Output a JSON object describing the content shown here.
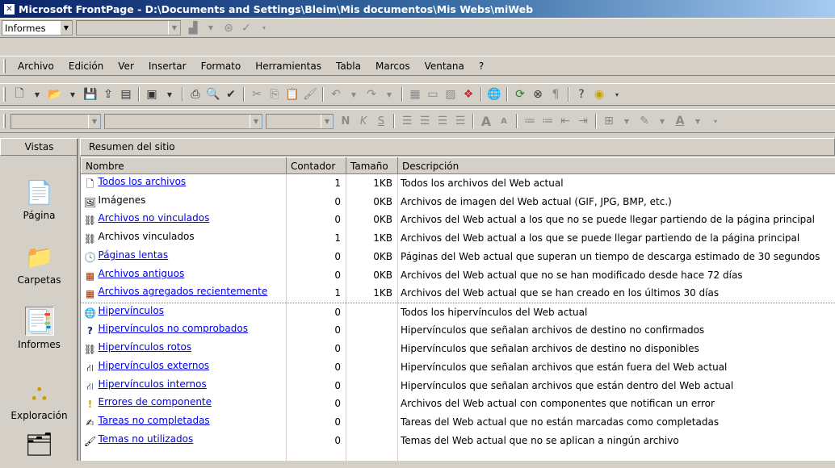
{
  "window": {
    "title": "Microsoft FrontPage - D:\\Documents and Settings\\Bleim\\Mis documentos\\Mis Webs\\miWeb"
  },
  "reporting_toolbar": {
    "report_select": "Informes"
  },
  "menu": [
    {
      "label": "Archivo"
    },
    {
      "label": "Edición"
    },
    {
      "label": "Ver"
    },
    {
      "label": "Insertar"
    },
    {
      "label": "Formato"
    },
    {
      "label": "Herramientas"
    },
    {
      "label": "Tabla"
    },
    {
      "label": "Marcos"
    },
    {
      "label": "Ventana"
    },
    {
      "label": "?"
    }
  ],
  "format_toolbar": {
    "bold": "N",
    "italic": "K",
    "underline": "S"
  },
  "views": {
    "header": "Vistas",
    "items": [
      {
        "label": "Página",
        "icon": "page-view-icon"
      },
      {
        "label": "Carpetas",
        "icon": "folder-view-icon"
      },
      {
        "label": "Informes",
        "icon": "reports-view-icon"
      },
      {
        "label": "Exploración",
        "icon": "navigation-view-icon"
      }
    ]
  },
  "report": {
    "title": "Resumen del sitio",
    "columns": [
      "Nombre",
      "Contador",
      "Tamaño",
      "Descripción"
    ],
    "rows": [
      {
        "name": "Todos los archivos",
        "count": "1",
        "size": "1KB",
        "desc": "Todos los archivos del Web actual"
      },
      {
        "name": "Imágenes",
        "count": "0",
        "size": "0KB",
        "desc": "Archivos de imagen del Web actual (GIF, JPG, BMP, etc.)"
      },
      {
        "name": "Archivos no vinculados",
        "count": "0",
        "size": "0KB",
        "desc": "Archivos del Web actual a los que no se puede llegar partiendo de la página principal"
      },
      {
        "name": "Archivos vinculados",
        "count": "1",
        "size": "1KB",
        "desc": "Archivos del Web actual a los que se puede llegar partiendo de la página principal"
      },
      {
        "name": "Páginas lentas",
        "count": "0",
        "size": "0KB",
        "desc": "Páginas del Web actual que superan un tiempo de descarga estimado de 30 segundos"
      },
      {
        "name": "Archivos antiguos",
        "count": "0",
        "size": "0KB",
        "desc": "Archivos del Web actual que no se han modificado desde hace 72 días"
      },
      {
        "name": "Archivos agregados recientemente",
        "count": "1",
        "size": "1KB",
        "desc": "Archivos del Web actual que se han creado en los últimos 30 días"
      },
      {
        "name": "Hipervínculos",
        "count": "0",
        "size": "",
        "desc": "Todos los hipervínculos del Web actual"
      },
      {
        "name": "Hipervínculos no comprobados",
        "count": "0",
        "size": "",
        "desc": "Hipervínculos que señalan archivos de destino no confirmados"
      },
      {
        "name": "Hipervínculos rotos",
        "count": "0",
        "size": "",
        "desc": "Hipervínculos que señalan archivos de destino no disponibles"
      },
      {
        "name": "Hipervínculos externos",
        "count": "0",
        "size": "",
        "desc": "Hipervínculos que señalan archivos que están fuera del Web actual"
      },
      {
        "name": "Hipervínculos internos",
        "count": "0",
        "size": "",
        "desc": "Hipervínculos que señalan archivos que están dentro del Web actual"
      },
      {
        "name": "Errores de componente",
        "count": "0",
        "size": "",
        "desc": "Archivos del Web actual con componentes que notifican un error"
      },
      {
        "name": "Tareas no completadas",
        "count": "0",
        "size": "",
        "desc": "Tareas del Web actual que no están marcadas como completadas"
      },
      {
        "name": "Temas no utilizados",
        "count": "0",
        "size": "",
        "desc": "Temas del Web actual que no se aplican a ningún archivo"
      }
    ]
  }
}
